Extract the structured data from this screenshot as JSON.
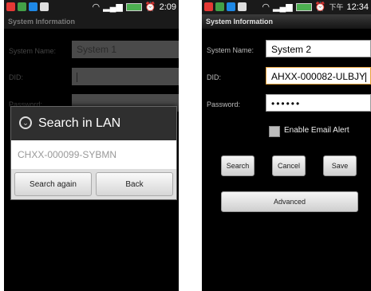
{
  "left_screen": {
    "status": {
      "time": "2:09"
    },
    "title": "System Information",
    "fields": {
      "system_name_label": "System Name:",
      "system_name_value": "System 1",
      "did_label": "DID:",
      "did_value": "",
      "password_label": "Password:"
    },
    "dialog": {
      "title": "Search in LAN",
      "result_item": "CHXX-000099-SYBMN",
      "search_again_label": "Search again",
      "back_label": "Back"
    }
  },
  "right_screen": {
    "status": {
      "time": "12:34",
      "carrier_glyph": "下午"
    },
    "title": "System Information",
    "fields": {
      "system_name_label": "System Name:",
      "system_name_value": "System 2",
      "did_label": "DID:",
      "did_value": "AHXX-000082-ULBJY",
      "password_label": "Password:",
      "password_value": "••••••"
    },
    "email_alert_label": "Enable Email Alert",
    "buttons": {
      "search": "Search",
      "cancel": "Cancel",
      "save": "Save",
      "advanced": "Advanced"
    }
  },
  "colors": {
    "phone_bg": "#000000",
    "input_dim": "#4a4a4a",
    "dialog_header": "#2f2f2f"
  }
}
